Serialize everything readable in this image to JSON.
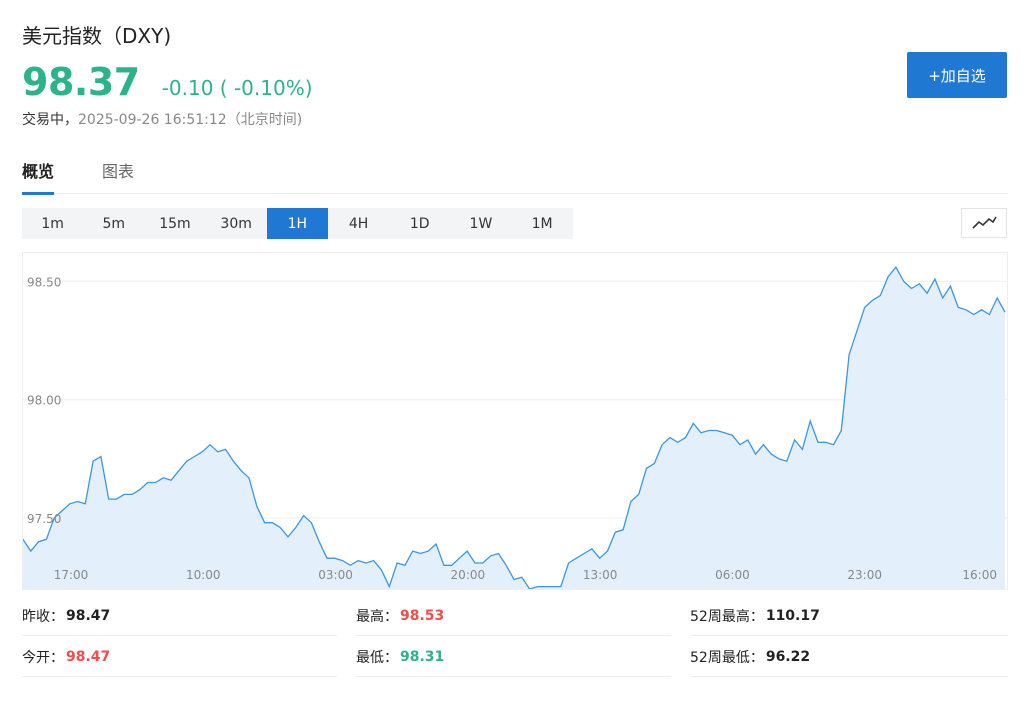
{
  "header": {
    "title": "美元指数（DXY)",
    "price": "98.37",
    "change": "-0.10 ( -0.10%)",
    "status_label": "交易中，",
    "status_time": "2025-09-26 16:51:12（北京时间)",
    "add_button": "+加自选"
  },
  "tabs": [
    {
      "label": "概览",
      "active": true
    },
    {
      "label": "图表",
      "active": false
    }
  ],
  "ranges": [
    {
      "label": "1m"
    },
    {
      "label": "5m"
    },
    {
      "label": "15m"
    },
    {
      "label": "30m"
    },
    {
      "label": "1H",
      "active": true
    },
    {
      "label": "4H"
    },
    {
      "label": "1D"
    },
    {
      "label": "1W"
    },
    {
      "label": "1M"
    }
  ],
  "colors": {
    "accent": "#1f78d1",
    "up": "#f04e4e",
    "down": "#2db38c",
    "line": "#3c96e0",
    "area": "#e3effb"
  },
  "chart_data": {
    "type": "area",
    "ylim": [
      97.2,
      98.62
    ],
    "yticks": [
      97.5,
      98.0,
      98.5
    ],
    "ytick_labels": [
      "97.50",
      "98.00",
      "98.50"
    ],
    "xtick_labels": [
      "17:00",
      "10:00",
      "03:00",
      "20:00",
      "13:00",
      "06:00",
      "23:00",
      "16:00"
    ],
    "values": [
      97.41,
      97.36,
      97.4,
      97.41,
      97.5,
      97.53,
      97.56,
      97.57,
      97.56,
      97.74,
      97.76,
      97.58,
      97.58,
      97.6,
      97.6,
      97.62,
      97.65,
      97.65,
      97.67,
      97.66,
      97.7,
      97.74,
      97.76,
      97.78,
      97.81,
      97.78,
      97.79,
      97.74,
      97.7,
      97.67,
      97.55,
      97.48,
      97.48,
      97.46,
      97.42,
      97.46,
      97.51,
      97.48,
      97.4,
      97.33,
      97.33,
      97.32,
      97.3,
      97.32,
      97.31,
      97.32,
      97.28,
      97.21,
      97.31,
      97.3,
      97.36,
      97.35,
      97.36,
      97.39,
      97.3,
      97.3,
      97.33,
      97.36,
      97.31,
      97.31,
      97.34,
      97.35,
      97.3,
      97.24,
      97.25,
      97.2,
      97.21,
      97.21,
      97.21,
      97.21,
      97.31,
      97.33,
      97.35,
      97.37,
      97.33,
      97.36,
      97.44,
      97.45,
      97.57,
      97.6,
      97.71,
      97.73,
      97.81,
      97.84,
      97.82,
      97.84,
      97.9,
      97.86,
      97.87,
      97.87,
      97.86,
      97.85,
      97.81,
      97.83,
      97.77,
      97.81,
      97.77,
      97.75,
      97.74,
      97.83,
      97.79,
      97.91,
      97.82,
      97.82,
      97.81,
      97.87,
      98.19,
      98.29,
      98.39,
      98.42,
      98.44,
      98.52,
      98.56,
      98.5,
      98.47,
      98.49,
      98.45,
      98.51,
      98.43,
      98.48,
      98.39,
      98.38,
      98.36,
      98.38,
      98.36,
      98.43,
      98.37
    ]
  },
  "stats": [
    {
      "label": "昨收：",
      "value": "98.47",
      "tone": "dark"
    },
    {
      "label": "最高：",
      "value": "98.53",
      "tone": "red"
    },
    {
      "label": "52周最高：",
      "value": "110.17",
      "tone": "dark"
    },
    {
      "label": "今开：",
      "value": "98.47",
      "tone": "red"
    },
    {
      "label": "最低：",
      "value": "98.31",
      "tone": "green"
    },
    {
      "label": "52周最低：",
      "value": "96.22",
      "tone": "dark"
    }
  ]
}
